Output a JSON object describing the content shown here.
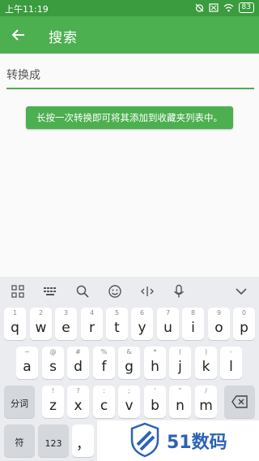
{
  "status": {
    "time": "上午11:19",
    "battery": "83"
  },
  "appbar": {
    "title": "搜索"
  },
  "search": {
    "placeholder": "转换成"
  },
  "toast": {
    "text": "长按一次转换即可将其添加到收藏夹列表中。"
  },
  "keyboard": {
    "row1": [
      {
        "hint": "1",
        "key": "q"
      },
      {
        "hint": "2",
        "key": "w"
      },
      {
        "hint": "3",
        "key": "e"
      },
      {
        "hint": "4",
        "key": "r"
      },
      {
        "hint": "5",
        "key": "t"
      },
      {
        "hint": "6",
        "key": "y"
      },
      {
        "hint": "7",
        "key": "u"
      },
      {
        "hint": "8",
        "key": "i"
      },
      {
        "hint": "9",
        "key": "o"
      },
      {
        "hint": "0",
        "key": "p"
      }
    ],
    "row2": [
      {
        "hint": "~",
        "key": "a"
      },
      {
        "hint": "@",
        "key": "s"
      },
      {
        "hint": "#",
        "key": "d"
      },
      {
        "hint": "%",
        "key": "f"
      },
      {
        "hint": "&",
        "key": "g"
      },
      {
        "hint": "*",
        "key": "h"
      },
      {
        "hint": "(",
        "key": "j"
      },
      {
        "hint": ")",
        "key": "k"
      },
      {
        "hint": "-",
        "key": "l"
      }
    ],
    "row3": [
      {
        "hint": "!",
        "key": "z"
      },
      {
        "hint": "?",
        "key": "x"
      },
      {
        "hint": ":",
        "key": "c"
      },
      {
        "hint": ";",
        "key": "v"
      },
      {
        "hint": "'",
        "key": "b"
      },
      {
        "hint": "\"",
        "key": "n"
      },
      {
        "hint": "/",
        "key": "m"
      }
    ],
    "shift_label": "分词",
    "symbol_label": "符",
    "num_label": "123",
    "comma_label": "，"
  },
  "watermark": {
    "text": "51数码"
  },
  "colors": {
    "primary": "#4caf50",
    "status": "#3b9b3f",
    "accent_blue": "#2b63b8"
  }
}
